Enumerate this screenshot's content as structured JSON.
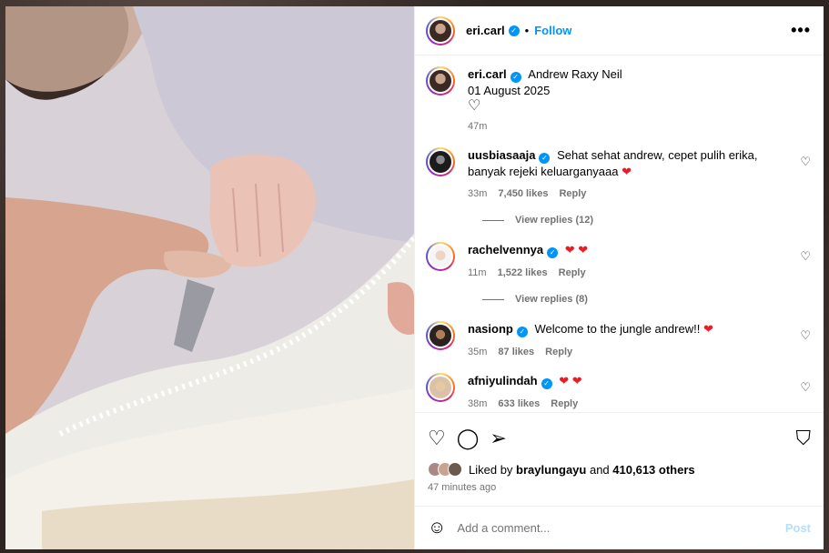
{
  "post": {
    "author": "eri.carl",
    "follow_label": "Follow",
    "separator": "•",
    "more_icon": "•••"
  },
  "caption": {
    "author": "eri.carl",
    "tagged": "Andrew Raxy Neil",
    "date": "01 August 2025",
    "heart": "♡",
    "time": "47m"
  },
  "comments": [
    {
      "user": "uusbiasaaja",
      "text": "Sehat sehat andrew, cepet pulih erika, banyak rejeki keluarganyaaa",
      "emoji": "❤",
      "time": "33m",
      "likes": "7,450 likes",
      "reply": "Reply",
      "view_replies": "View replies (12)"
    },
    {
      "user": "rachelvennya",
      "text": "",
      "emoji": "❤ ❤",
      "time": "11m",
      "likes": "1,522 likes",
      "reply": "Reply",
      "view_replies": "View replies (8)"
    },
    {
      "user": "nasionp",
      "text": "Welcome to the jungle andrew!!",
      "emoji": "❤",
      "time": "35m",
      "likes": "87 likes",
      "reply": "Reply"
    },
    {
      "user": "afniyulindah",
      "text": "",
      "emoji": "❤ ❤",
      "time": "38m",
      "likes": "633 likes",
      "reply": "Reply"
    }
  ],
  "actions": {
    "like_icon": "♡",
    "comment_icon": "◯",
    "share_icon": "➢",
    "save_icon": "⛉"
  },
  "likes": {
    "prefix": "Liked by",
    "user": "braylungayu",
    "and": "and",
    "count": "410,613 others",
    "time_ago": "47 minutes ago"
  },
  "add_comment": {
    "emoji_icon": "☺",
    "placeholder": "Add a comment...",
    "post_label": "Post"
  },
  "colors": {
    "accent": "#0095f6",
    "heart": "#ed1c24",
    "post_disabled": "#b2dffc"
  }
}
